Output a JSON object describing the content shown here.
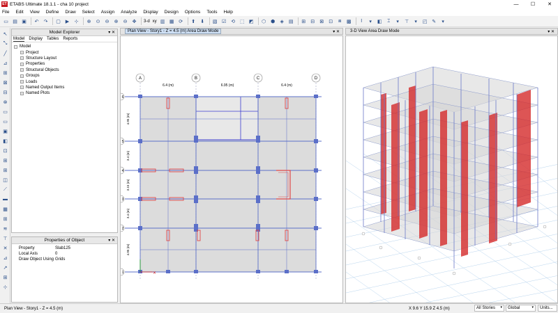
{
  "window": {
    "title": "ETABS Ultimate 18.1.1 - cha 10 project",
    "logo": "ET",
    "controls": [
      "—",
      "☐",
      "✕"
    ]
  },
  "menu": [
    "File",
    "Edit",
    "View",
    "Define",
    "Draw",
    "Select",
    "Assign",
    "Analyze",
    "Display",
    "Design",
    "Options",
    "Tools",
    "Help"
  ],
  "toolbar": {
    "three_d": "3-d",
    "xy": "xy"
  },
  "model_explorer": {
    "title": "Model Explorer",
    "tabs": [
      "Model",
      "Display",
      "Tables",
      "Reports"
    ],
    "root": "Model",
    "items": [
      "Project",
      "Structure Layout",
      "Properties",
      "Structural Objects",
      "Groups",
      "Loads",
      "Named Output Items",
      "Named Plots"
    ]
  },
  "properties_panel": {
    "title": "Properties of Object",
    "rows": [
      {
        "key": "Property",
        "value": "Slab125"
      },
      {
        "key": "Local Axis",
        "value": "0"
      },
      {
        "key": "Draw Object Using",
        "value": "Grids"
      }
    ]
  },
  "plan_view": {
    "title": "Plan View - Story1 - Z = 4.5 (m)  Area Draw Mode",
    "grid_letters": [
      "A",
      "B",
      "C",
      "D"
    ],
    "grid_numbers": [
      "6",
      "5",
      "4",
      "3",
      "2",
      "1"
    ],
    "x_spacings": [
      "6.4 (m)",
      "6.95 (m)",
      "6.4 (m)"
    ],
    "y_spacings": [
      "4.95 (m)",
      "3.4 (m)",
      "3.15 (m)",
      "3.4 (m)",
      "4.95 (m)"
    ]
  },
  "view3d": {
    "title": "3-D View  Area Draw Mode"
  },
  "status": {
    "left": "Plan View - Story1 - Z = 4.5 (m)",
    "coords": "X 9.6  Y 15.9  Z 4.5 (m)",
    "stories": "All Stories",
    "coord_sys": "Global",
    "units": "Units..."
  },
  "colors": {
    "slab": "#dcdcdc",
    "beam": "#5b6fc8",
    "wall": "#e04848",
    "active_tab": "#cfe0f5"
  }
}
